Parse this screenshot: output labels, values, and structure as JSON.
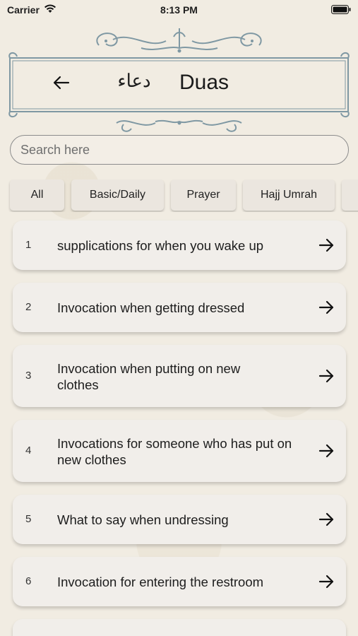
{
  "status": {
    "carrier": "Carrier",
    "time": "8:13 PM"
  },
  "header": {
    "arabic_title": "دعاء",
    "title": "Duas"
  },
  "search": {
    "placeholder": "Search here"
  },
  "filters": [
    "All",
    "Basic/Daily",
    "Prayer",
    "Hajj Umrah"
  ],
  "duas": [
    {
      "num": "1",
      "text": "supplications for when you wake up"
    },
    {
      "num": "2",
      "text": "Invocation when getting dressed"
    },
    {
      "num": "3",
      "text": "Invocation when putting on new clothes"
    },
    {
      "num": "4",
      "text": "Invocations for someone who has put on new clothes"
    },
    {
      "num": "5",
      "text": "What to say when undressing"
    },
    {
      "num": "6",
      "text": "Invocation for entering the restroom"
    }
  ],
  "colors": {
    "frame": "#7f98a3",
    "background": "#f1ece2",
    "card": "#f1eeea"
  },
  "icons": {
    "back": "arrow-left-icon",
    "row": "arrow-right-icon",
    "wifi": "wifi-icon",
    "battery": "battery-icon"
  }
}
